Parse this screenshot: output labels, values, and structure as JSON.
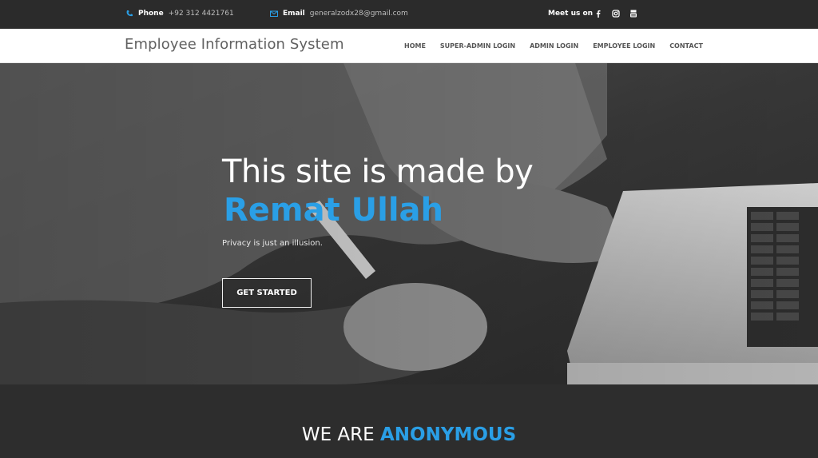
{
  "topbar": {
    "phone_label": "Phone",
    "phone_value": "+92 312 4421761",
    "email_label": "Email",
    "email_value": "generalzodx28@gmail.com",
    "meet_label": "Meet us on",
    "social_icons": [
      "facebook-icon",
      "instagram-icon",
      "youtube-icon"
    ]
  },
  "navbar": {
    "brand": "Employee Information System",
    "items": [
      {
        "label": "HOME"
      },
      {
        "label": "SUPER-ADMIN LOGIN"
      },
      {
        "label": "ADMIN LOGIN"
      },
      {
        "label": "EMPLOYEE LOGIN"
      },
      {
        "label": "CONTACT"
      }
    ]
  },
  "hero": {
    "title": "This site is made by",
    "accent": "Remat Ullah",
    "subtitle": "Privacy is just an illusion.",
    "button": "GET STARTED"
  },
  "about": {
    "prefix": "WE ARE",
    "highlight": "ANONYMOUS"
  },
  "colors": {
    "accent": "#2a9fe6",
    "dark": "#2b2b2b",
    "nav_bg": "#ffffff"
  }
}
